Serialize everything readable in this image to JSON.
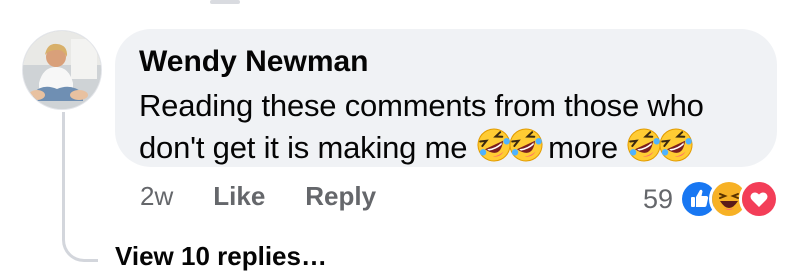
{
  "comment": {
    "author": "Wendy Newman",
    "text_part1": "Reading these comments from those who don't get it is making me",
    "text_part2": "more",
    "emoji_1": "rolling-on-floor-laughing",
    "emoji_2": "rolling-on-floor-laughing"
  },
  "actions": {
    "timestamp": "2w",
    "like_label": "Like",
    "reply_label": "Reply"
  },
  "reactions": {
    "count": "59",
    "types": [
      "like",
      "haha",
      "love"
    ],
    "colors": {
      "like": "#1877f2",
      "haha": "#f7b125",
      "love": "#f33e58"
    }
  },
  "replies": {
    "label": "View 10 replies…"
  }
}
